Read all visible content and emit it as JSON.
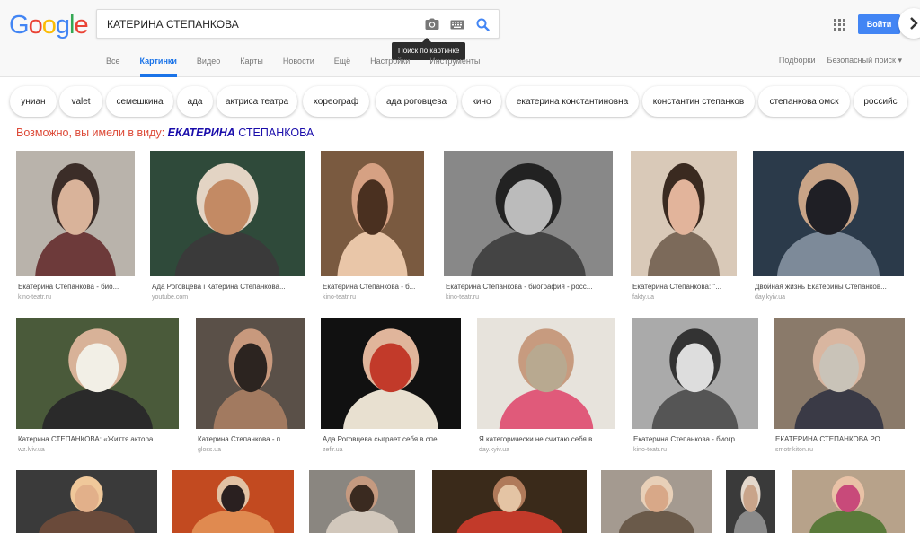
{
  "logo": [
    "G",
    "o",
    "o",
    "g",
    "l",
    "e"
  ],
  "logo_colors": [
    "#4285f4",
    "#ea4335",
    "#fbbc05",
    "#4285f4",
    "#34a853",
    "#ea4335"
  ],
  "search": {
    "value": "КАТЕРИНА СТЕПАНКОВА",
    "camera_icon": "camera-icon",
    "keyboard_icon": "keyboard-icon",
    "search_icon": "search-icon",
    "tooltip": "Поиск по картинке"
  },
  "header": {
    "apps_icon": "apps-grid-icon",
    "login": "Войти",
    "accent": "#4285f4"
  },
  "tabs": [
    {
      "label": "Все"
    },
    {
      "label": "Картинки",
      "active": true
    },
    {
      "label": "Видео"
    },
    {
      "label": "Карты"
    },
    {
      "label": "Новости"
    },
    {
      "label": "Ещё"
    },
    {
      "label": "Настройки"
    },
    {
      "label": "Инструменты"
    }
  ],
  "tools": {
    "collections": "Подборки",
    "safe_search": "Безопасный поиск ▾"
  },
  "chips": [
    "униан",
    "valet",
    "семешкина",
    "ада",
    "актриса театра",
    "хореограф",
    "ада роговцева",
    "кино",
    "екатерина константиновна",
    "константин степанков",
    "степанкова омск",
    "российс"
  ],
  "chip_next_icon": "chevron-right-icon",
  "did_you_mean": {
    "prefix": "Возможно, вы имели в виду:",
    "suggestion_bold": "ЕКАТЕРИНА",
    "suggestion_rest": "СТЕПАНКОВА"
  },
  "results": [
    {
      "title": "Екатерина Степанкова - био...",
      "domain": "kino-teatr.ru"
    },
    {
      "title": "Ада Роговцева і Катерина Степанкова...",
      "domain": "youtube.com"
    },
    {
      "title": "Екатерина Степанкова - б...",
      "domain": "kino-teatr.ru"
    },
    {
      "title": "Екатерина Степанкова - биография - росс...",
      "domain": "kino-teatr.ru"
    },
    {
      "title": "Екатерина Степанкова: \"...",
      "domain": "fakty.ua"
    },
    {
      "title": "Двойная жизнь Екатерины Степанков...",
      "domain": "day.kyiv.ua"
    },
    {
      "title": "Катерина СТЕПАНКОВА: «Життя актора ...",
      "domain": "wz.lviv.ua"
    },
    {
      "title": "Катерина Степанкова - п...",
      "domain": "gloss.ua"
    },
    {
      "title": "Ада Роговцева сыграет себя в спе...",
      "domain": "zefir.ua"
    },
    {
      "title": "Я категорически не считаю себя в...",
      "domain": "day.kyiv.ua"
    },
    {
      "title": "Екатерина Степанкова - биогр...",
      "domain": "kino-teatr.ru"
    },
    {
      "title": "ЕКАТЕРИНА СТЕПАНКОВА РО...",
      "domain": "smotrikiton.ru"
    },
    {
      "title": "",
      "domain": ""
    },
    {
      "title": "",
      "domain": ""
    },
    {
      "title": "",
      "domain": ""
    },
    {
      "title": "",
      "domain": ""
    },
    {
      "title": "",
      "domain": ""
    },
    {
      "title": "",
      "domain": ""
    },
    {
      "title": "",
      "domain": ""
    }
  ],
  "colors": {
    "did_you_mean": "#dd4b39",
    "link": "#1a0dab",
    "active_tab": "#1a73e8"
  }
}
